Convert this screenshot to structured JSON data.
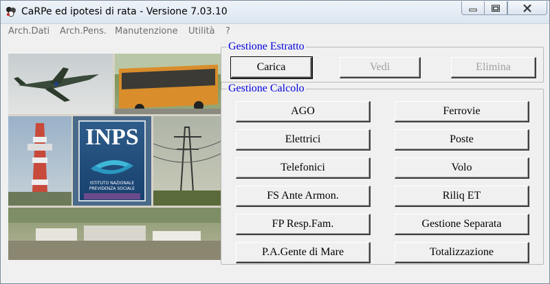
{
  "window": {
    "title": "CaRPe ed ipotesi di rata  -  Versione 7.03.10"
  },
  "menu": {
    "items": [
      "Arch.Dati",
      "Arch.Pens.",
      "Manutenzione",
      "Utilità",
      "?"
    ]
  },
  "logo": {
    "main": "INPS",
    "line1": "ISTITUTO NAZIONALE",
    "line2": "PREVIDENZA SOCIALE"
  },
  "estratto": {
    "legend": "Gestione Estratto",
    "buttons": [
      {
        "label": "Carica",
        "enabled": true
      },
      {
        "label": "Vedi",
        "enabled": false
      },
      {
        "label": "Elimina",
        "enabled": false
      }
    ]
  },
  "calcolo": {
    "legend": "Gestione Calcolo",
    "left_buttons": [
      "AGO",
      "Elettrici",
      "Telefonici",
      "FS Ante Armon.",
      "FP Resp.Fam.",
      "P.A.Gente di Mare"
    ],
    "right_buttons": [
      "Ferrovie",
      "Poste",
      "Volo",
      "Riliq ET",
      "Gestione Separata",
      "Totalizzazione"
    ]
  },
  "colors": {
    "legend": "#0000dd",
    "disabled_text": "#a0a0a0"
  }
}
